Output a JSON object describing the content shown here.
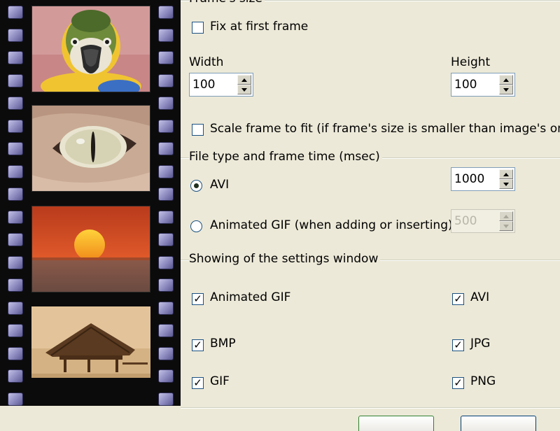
{
  "frames_size": {
    "title": "Frame's size",
    "fix_first_frame": {
      "label": "Fix at first frame",
      "checked": false
    },
    "width": {
      "label": "Width",
      "value": "100"
    },
    "height": {
      "label": "Height",
      "value": "100"
    },
    "scale_to_fit": {
      "label": "Scale frame to fit (if frame's size is smaller than image's one)",
      "checked": false
    }
  },
  "file_type": {
    "title": "File type and frame time (msec)",
    "avi": {
      "label": "AVI",
      "selected": true,
      "time": "1000"
    },
    "gif": {
      "label": "Animated GIF (when adding or inserting)",
      "selected": false,
      "time": "500",
      "disabled": true
    }
  },
  "settings_window": {
    "title": "Showing of the settings window",
    "items": [
      {
        "label": "Animated GIF",
        "checked": true
      },
      {
        "label": "AVI",
        "checked": true
      },
      {
        "label": "BMP",
        "checked": true
      },
      {
        "label": "JPG",
        "checked": true
      },
      {
        "label": "GIF",
        "checked": true
      },
      {
        "label": "PNG",
        "checked": true
      }
    ]
  },
  "filmstrip": {
    "frames": [
      "parrot",
      "cat-eye",
      "sunset",
      "hut-on-water"
    ]
  },
  "colors": {
    "dialog_bg": "#ece9d8",
    "control_border": "#1c5180",
    "film_black": "#0b0b0b",
    "sprocket": "#8a88bd"
  }
}
